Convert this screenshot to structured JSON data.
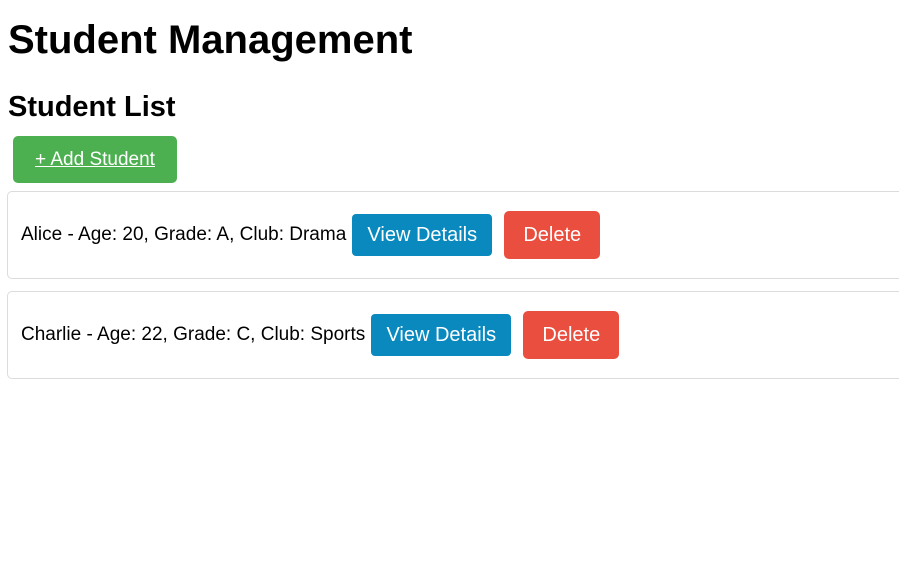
{
  "page": {
    "title": "Student Management",
    "section_title": "Student List"
  },
  "toolbar": {
    "add_label": "+ Add Student"
  },
  "students": [
    {
      "summary": "Alice - Age: 20, Grade: A, Club: Drama",
      "view_label": "View Details",
      "delete_label": "Delete"
    },
    {
      "summary": "Charlie - Age: 22, Grade: C, Club: Sports",
      "view_label": "View Details",
      "delete_label": "Delete"
    }
  ],
  "colors": {
    "add_button": "#4caf50",
    "view_button": "#0a89bf",
    "delete_button": "#e94e3f",
    "card_border": "#dcdcdc"
  }
}
